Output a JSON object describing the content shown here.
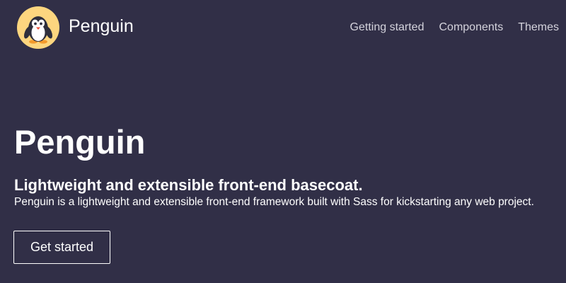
{
  "navbar": {
    "brand_name": "Penguin",
    "logo_icon": "penguin-logo-icon",
    "links": [
      {
        "label": "Getting started"
      },
      {
        "label": "Components"
      },
      {
        "label": "Themes"
      }
    ]
  },
  "hero": {
    "title": "Penguin",
    "subtitle": "Lightweight and extensible front-end basecoat.",
    "lead": "Penguin is a lightweight and extensible front-end framework built with Sass for kickstarting any web project.",
    "cta_label": "Get started"
  },
  "colors": {
    "background": "#312f47",
    "logo_circle": "#fdd67f",
    "text": "#ffffff",
    "nav_link": "#d4d3dc"
  }
}
